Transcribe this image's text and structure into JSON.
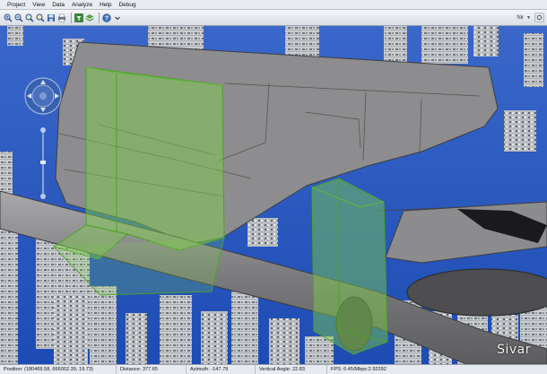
{
  "menu": [
    "Project",
    "View",
    "Data",
    "Analyze",
    "Help",
    "Debug"
  ],
  "toolbar": {
    "buttons": [
      {
        "name": "zoom-in-icon"
      },
      {
        "name": "zoom-out-icon"
      },
      {
        "name": "zoom-window-icon"
      },
      {
        "name": "zoom-extent-icon"
      },
      {
        "name": "save-icon"
      },
      {
        "name": "print-icon"
      },
      {
        "name": "filter-icon"
      },
      {
        "name": "layer-icon"
      },
      {
        "name": "help-icon"
      }
    ],
    "view_mode": "Nir"
  },
  "status": {
    "position": "Position: (180469.58, 666002.39, 19.73)",
    "distance": "Distance: 377.65",
    "azimuth": "Azimuth: -147.79",
    "vertical_angle": "Vertical Angle: 22.83",
    "fps": "FPS: 6.45/Mbps:2.92292"
  },
  "watermark": "Sivar",
  "colors": {
    "sky": "#2350b8",
    "building": "#c9ccd0",
    "structure": "#8d8d8f",
    "selection": "#7fd04a"
  }
}
